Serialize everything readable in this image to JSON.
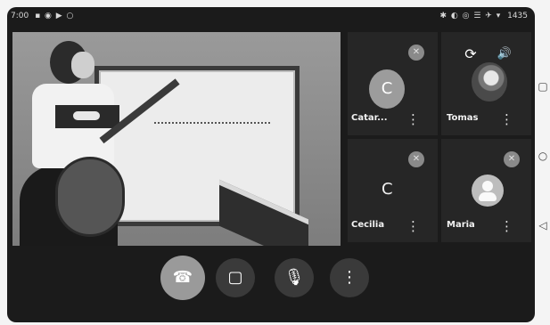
{
  "statusbar": {
    "time": "7:00",
    "left_icons": "▪ ◉ ▶ ○",
    "right_icons": "✱ ◐ ◎ ☰ ✈ ▾",
    "battery_text": "1435"
  },
  "main_video": {
    "participant": "Live camera feed"
  },
  "participants": [
    {
      "name": "Catar...",
      "avatar_letter": "C"
    },
    {
      "name": "Tomas",
      "avatar_letter": ""
    },
    {
      "name": "Cecilia",
      "avatar_letter": "C"
    },
    {
      "name": "Maria",
      "avatar_letter": ""
    }
  ],
  "icons": {
    "more": "⋮",
    "switch_camera": "⟳",
    "speaker": "🔊",
    "end_call": "☎",
    "camera": "▢",
    "mic": "🎙",
    "mute": "✕",
    "nav_square": "▢",
    "nav_circle": "○",
    "nav_back": "◁"
  },
  "colors": {
    "background": "#1b1b1b",
    "tile": "#262626",
    "control": "#3a3a3a",
    "end_call": "#9a9a9a"
  }
}
